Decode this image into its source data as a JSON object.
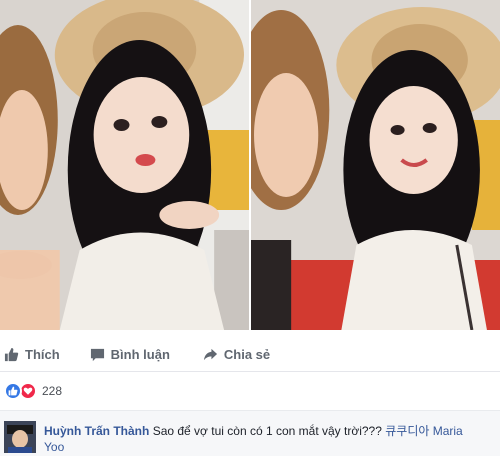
{
  "post": {
    "photos": [
      {
        "name": "selfie-left"
      },
      {
        "name": "selfie-right"
      }
    ]
  },
  "actions": {
    "like_label": "Thích",
    "comment_label": "Bình luận",
    "share_label": "Chia sẻ"
  },
  "reactions": {
    "icons": [
      "like-reaction-icon",
      "love-reaction-icon"
    ],
    "count": "228",
    "colors": {
      "like": "#3578e5",
      "love": "#f0284a"
    }
  },
  "comment": {
    "author": "Huỳnh Trấn Thành",
    "text": "Sao để vợ tui còn có 1 con mắt vậy trời???",
    "tagged_user": "큐쿠디아 Maria Yoo"
  },
  "colors": {
    "link": "#365899",
    "action_text": "#606770",
    "comment_bg": "#f6f7f9"
  }
}
